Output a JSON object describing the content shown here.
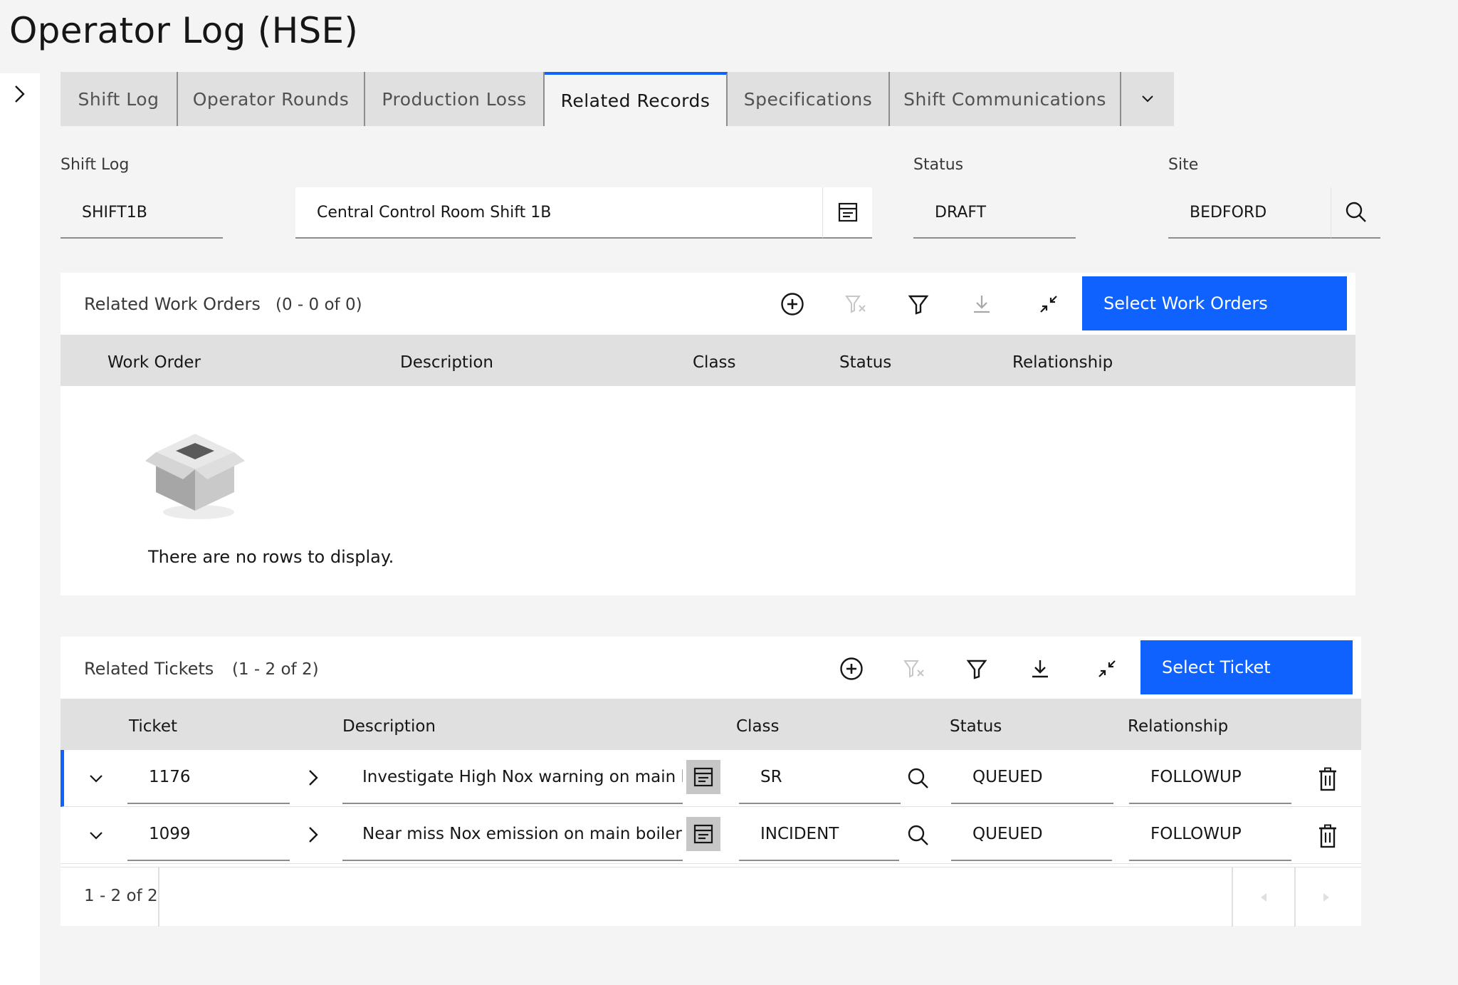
{
  "page": {
    "title": "Operator Log (HSE)"
  },
  "tabs": [
    {
      "label": "Shift Log"
    },
    {
      "label": "Operator Rounds"
    },
    {
      "label": "Production Loss"
    },
    {
      "label": "Related Records"
    },
    {
      "label": "Specifications"
    },
    {
      "label": "Shift Communications"
    }
  ],
  "header": {
    "shift_log_label": "Shift Log",
    "shift_log_value": "SHIFT1B",
    "description_value": "Central Control Room Shift 1B",
    "status_label": "Status",
    "status_value": "DRAFT",
    "site_label": "Site",
    "site_value": "BEDFORD"
  },
  "work_orders": {
    "title": "Related Work Orders",
    "count": "(0 - 0 of 0)",
    "select_button": "Select Work Orders",
    "columns": [
      "Work Order",
      "Description",
      "Class",
      "Status",
      "Relationship"
    ],
    "empty_text": "There are no rows to display."
  },
  "tickets": {
    "title": "Related Tickets",
    "count": "(1 - 2 of 2)",
    "select_button": "Select Ticket",
    "columns": [
      "Ticket",
      "Description",
      "Class",
      "Status",
      "Relationship"
    ],
    "rows": [
      {
        "ticket": "1176",
        "description": "Investigate High Nox warning on main bo",
        "class": "SR",
        "status": "QUEUED",
        "relationship": "FOLLOWUP"
      },
      {
        "ticket": "1099",
        "description": "Near miss Nox emission on main boiler",
        "class": "INCIDENT",
        "status": "QUEUED",
        "relationship": "FOLLOWUP"
      }
    ],
    "pagination": "1 - 2 of 2"
  },
  "colors": {
    "accent": "#0f62fe",
    "tab_bg": "#e0e0e0",
    "page_bg": "#f4f4f4"
  }
}
